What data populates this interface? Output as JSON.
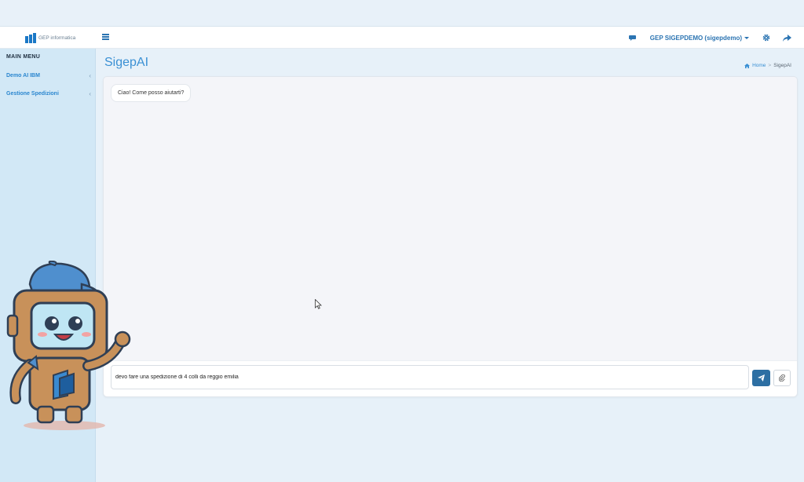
{
  "brand": {
    "logo_bold": "GEP",
    "logo_light": " informatica"
  },
  "navbar": {
    "user_label": "GEP SIGEPDEMO (sigepdemo)",
    "icons": [
      "hamburger-icon",
      "chat-icon",
      "gear-icon",
      "share-icon"
    ]
  },
  "sidebar": {
    "header": "MAIN MENU",
    "items": [
      {
        "label": "Demo AI IBM",
        "chevron": "‹"
      },
      {
        "label": "Gestione Spedizioni",
        "chevron": "‹"
      }
    ]
  },
  "page": {
    "title": "SigepAI"
  },
  "breadcrumb": {
    "home": "Home",
    "separator": ">",
    "current": "SigepAI"
  },
  "chat": {
    "messages": [
      {
        "from": "bot",
        "text": "Ciao! Come posso aiutarti?"
      }
    ],
    "input_value": "devo fare una spedizione di 4 colli da reggio emilia"
  },
  "colors": {
    "accent": "#3a90d4",
    "nav_link": "#2b74b2",
    "sidebar_bg": "#d2e8f6",
    "send_button": "#2d6fa3"
  }
}
